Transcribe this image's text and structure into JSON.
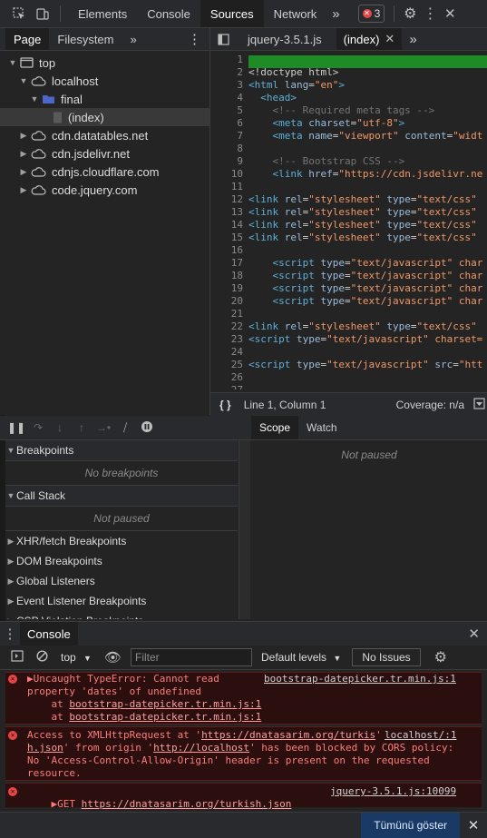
{
  "topbar": {
    "tabs": [
      "Elements",
      "Console",
      "Sources",
      "Network"
    ],
    "active_tab": "Sources",
    "more": "»",
    "error_count": "3"
  },
  "navigator": {
    "tabs": [
      "Page",
      "Filesystem"
    ],
    "more": "»",
    "tree": [
      {
        "label": "top",
        "level": 0,
        "icon": "frame-icon",
        "caret": "▼"
      },
      {
        "label": "localhost",
        "level": 1,
        "icon": "cloud-icon",
        "caret": "▼"
      },
      {
        "label": "final",
        "level": 2,
        "icon": "folder-icon",
        "caret": "▼"
      },
      {
        "label": "(index)",
        "level": 3,
        "icon": "file-icon",
        "caret": "",
        "selected": true
      },
      {
        "label": "cdn.datatables.net",
        "level": 1,
        "icon": "cloud-icon",
        "caret": "▶"
      },
      {
        "label": "cdn.jsdelivr.net",
        "level": 1,
        "icon": "cloud-icon",
        "caret": "▶"
      },
      {
        "label": "cdnjs.cloudflare.com",
        "level": 1,
        "icon": "cloud-icon",
        "caret": "▶"
      },
      {
        "label": "code.jquery.com",
        "level": 1,
        "icon": "cloud-icon",
        "caret": "▶"
      }
    ]
  },
  "editor": {
    "tabs": [
      "jquery-3.5.1.js",
      "(index)"
    ],
    "active_tab": "(index)",
    "status_position": "Line 1, Column 1",
    "coverage": "Coverage: n/a",
    "lines": [
      "",
      "<!doctype html>",
      "<html lang=\"en\">",
      "  <head>",
      "    <!-- Required meta tags -->",
      "    <meta charset=\"utf-8\">",
      "    <meta name=\"viewport\" content=\"widt",
      "",
      "    <!-- Bootstrap CSS -->",
      "    <link href=\"https://cdn.jsdelivr.ne",
      "",
      "<link rel=\"stylesheet\" type=\"text/css\"",
      "<link rel=\"stylesheet\" type=\"text/css\"",
      "<link rel=\"stylesheet\" type=\"text/css\"",
      "<link rel=\"stylesheet\" type=\"text/css\"",
      "",
      "    <script type=\"text/javascript\" char",
      "    <script type=\"text/javascript\" char",
      "    <script type=\"text/javascript\" char",
      "    <script type=\"text/javascript\" char",
      "",
      "<link rel=\"stylesheet\" type=\"text/css\"",
      "<script type=\"text/javascript\" charset=",
      "",
      "<script type=\"text/javascript\" src=\"htt",
      "",
      ""
    ]
  },
  "debugger": {
    "sections": [
      {
        "title": "Breakpoints",
        "expanded": true,
        "empty": "No breakpoints"
      },
      {
        "title": "Call Stack",
        "expanded": true,
        "empty": "Not paused"
      }
    ],
    "collapsed_sections": [
      "XHR/fetch Breakpoints",
      "DOM Breakpoints",
      "Global Listeners",
      "Event Listener Breakpoints",
      "CSP Violation Breakpoints"
    ],
    "scope_tabs": [
      "Scope",
      "Watch"
    ],
    "scope_empty": "Not paused"
  },
  "console": {
    "drawer_tab": "Console",
    "context": "top",
    "filter_placeholder": "Filter",
    "levels": "Default levels",
    "issues": "No Issues",
    "messages": [
      {
        "type": "error",
        "lines": [
          "▶Uncaught TypeError: Cannot read",
          "property 'dates' of undefined",
          "    at bootstrap-datepicker.tr.min.js:1",
          "    at bootstrap-datepicker.tr.min.js:1"
        ],
        "source": "bootstrap-datepicker.tr.min.js:1"
      },
      {
        "type": "error",
        "lines": [
          "Access to XMLHttpRequest at 'https://dnatasarim.org/turkis",
          "h.json' from origin 'http://localhost' has been blocked by CORS policy:",
          "No 'Access-Control-Allow-Origin' header is present on the requested",
          "resource."
        ],
        "source_lines": [
          "localhost/:1"
        ]
      },
      {
        "type": "error",
        "text_prefix": "▶GET ",
        "url": "https://dnatasarim.org/turkish.json",
        "source": "jquery-3.5.1.js:10099"
      }
    ],
    "show_all": "Tümünü göster"
  },
  "colors": {
    "panel_bg": "#242424",
    "toolbar_bg": "#292a2d",
    "error_red": "#e64545",
    "error_bg": "#2b0f0f",
    "tag": "#5db0d7",
    "attr": "#9bbbdc",
    "string": "#f29766",
    "comment": "#747474",
    "exec_line": "#1e8b27"
  }
}
